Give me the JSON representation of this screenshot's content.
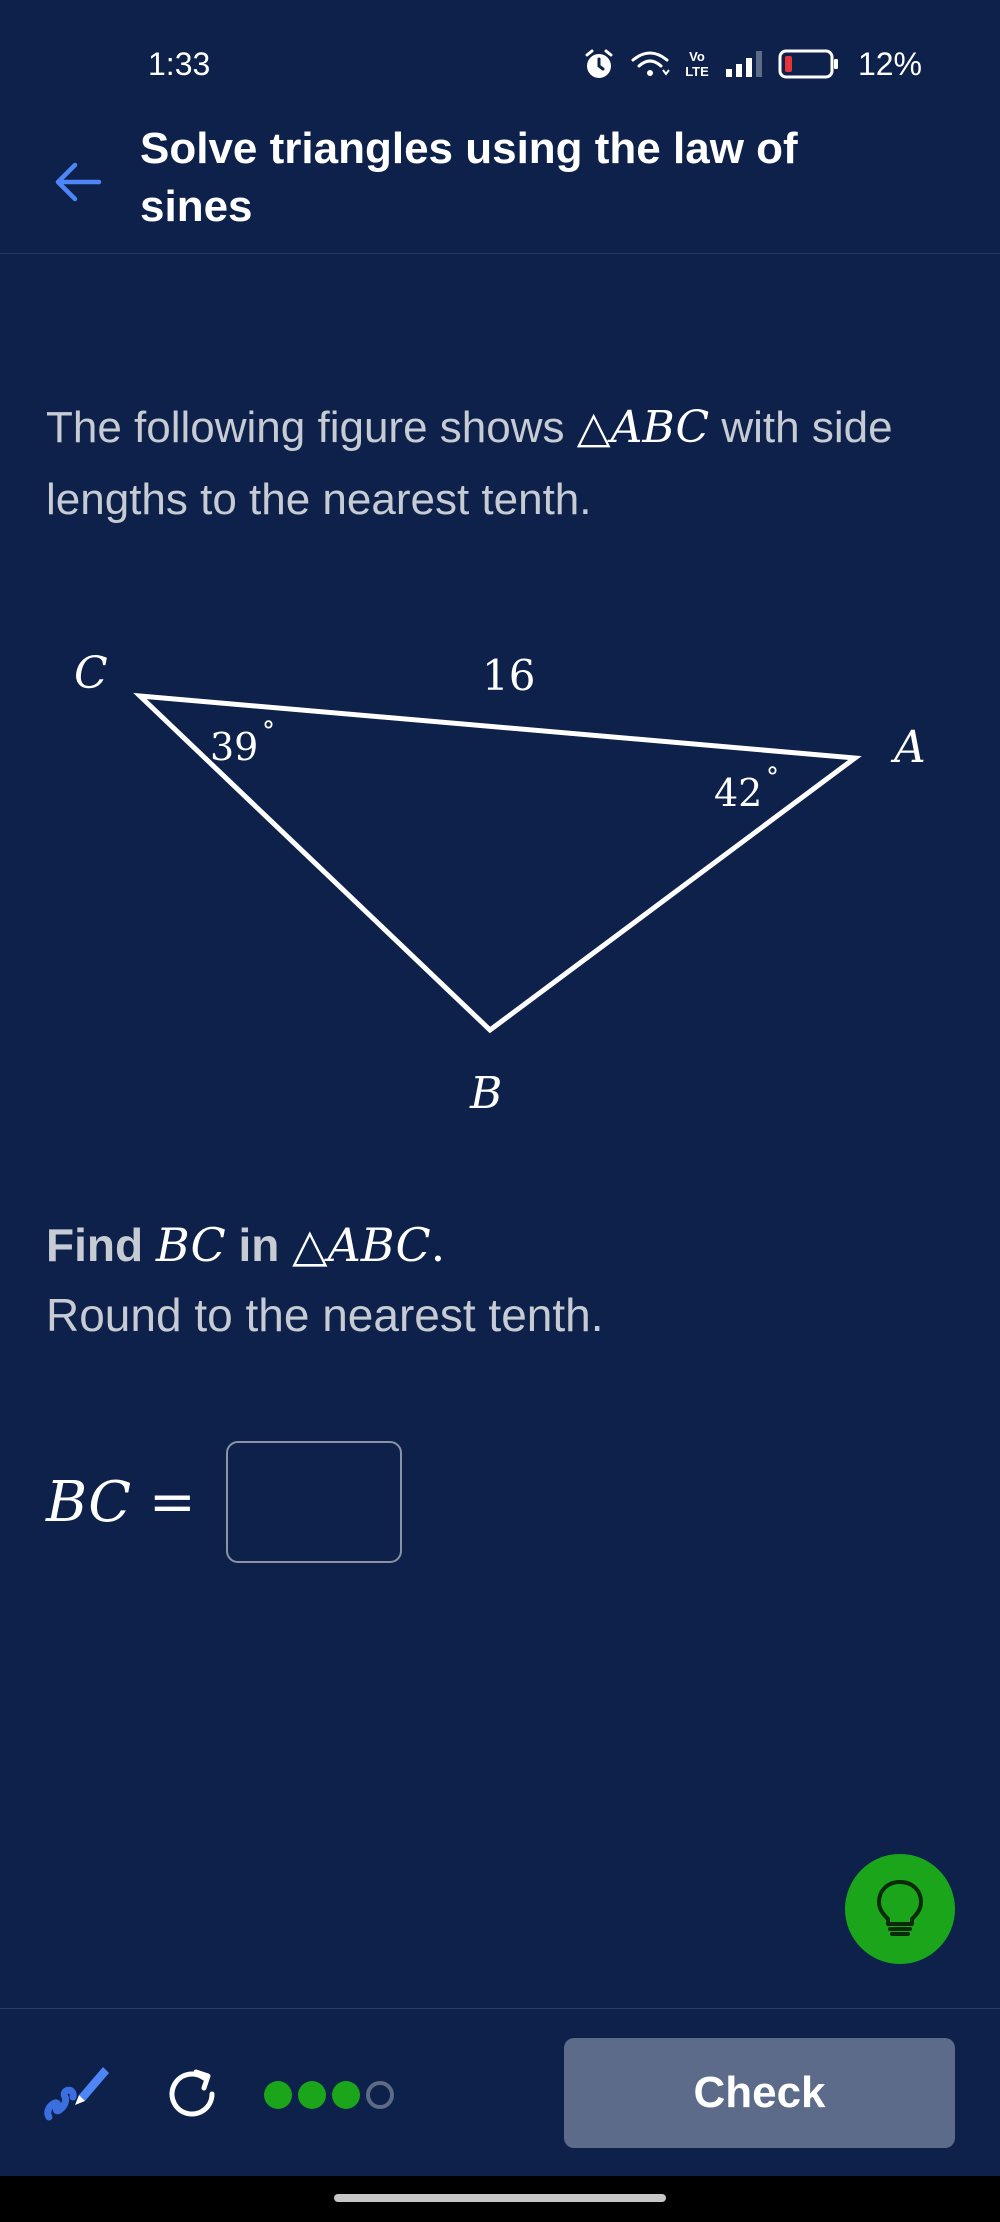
{
  "status_bar": {
    "time": "1:33",
    "network_label": "Vo LTE",
    "battery_percent": "12%"
  },
  "header": {
    "title": "Solve triangles using the law of sines"
  },
  "problem": {
    "text_before": "The following figure shows ",
    "triangle_symbol": "△",
    "triangle_name": "ABC",
    "text_after": " with side lengths to the nearest tenth."
  },
  "figure": {
    "vertex_c": "C",
    "vertex_a": "A",
    "vertex_b": "B",
    "side_ca_length": "16",
    "angle_c": "39",
    "angle_a": "42",
    "degree_symbol": "°"
  },
  "question": {
    "find_label": "Find",
    "segment": "BC",
    "in_label": "in",
    "triangle_symbol": "△",
    "triangle_name": "ABC",
    "period": ".",
    "instruction": "Round to the nearest tenth."
  },
  "answer": {
    "label": "BC =",
    "value": ""
  },
  "footer": {
    "check_label": "Check",
    "progress": {
      "completed": 3,
      "total": 4
    }
  },
  "colors": {
    "background": "#0d214a",
    "accent_green": "#1aa51a",
    "back_arrow_blue": "#4f86f7",
    "check_button": "#5b6b89"
  },
  "icons": {
    "back": "arrow-left-icon",
    "hint": "lightbulb-icon",
    "scratchpad": "pen-scribble-icon",
    "retry": "refresh-icon"
  }
}
